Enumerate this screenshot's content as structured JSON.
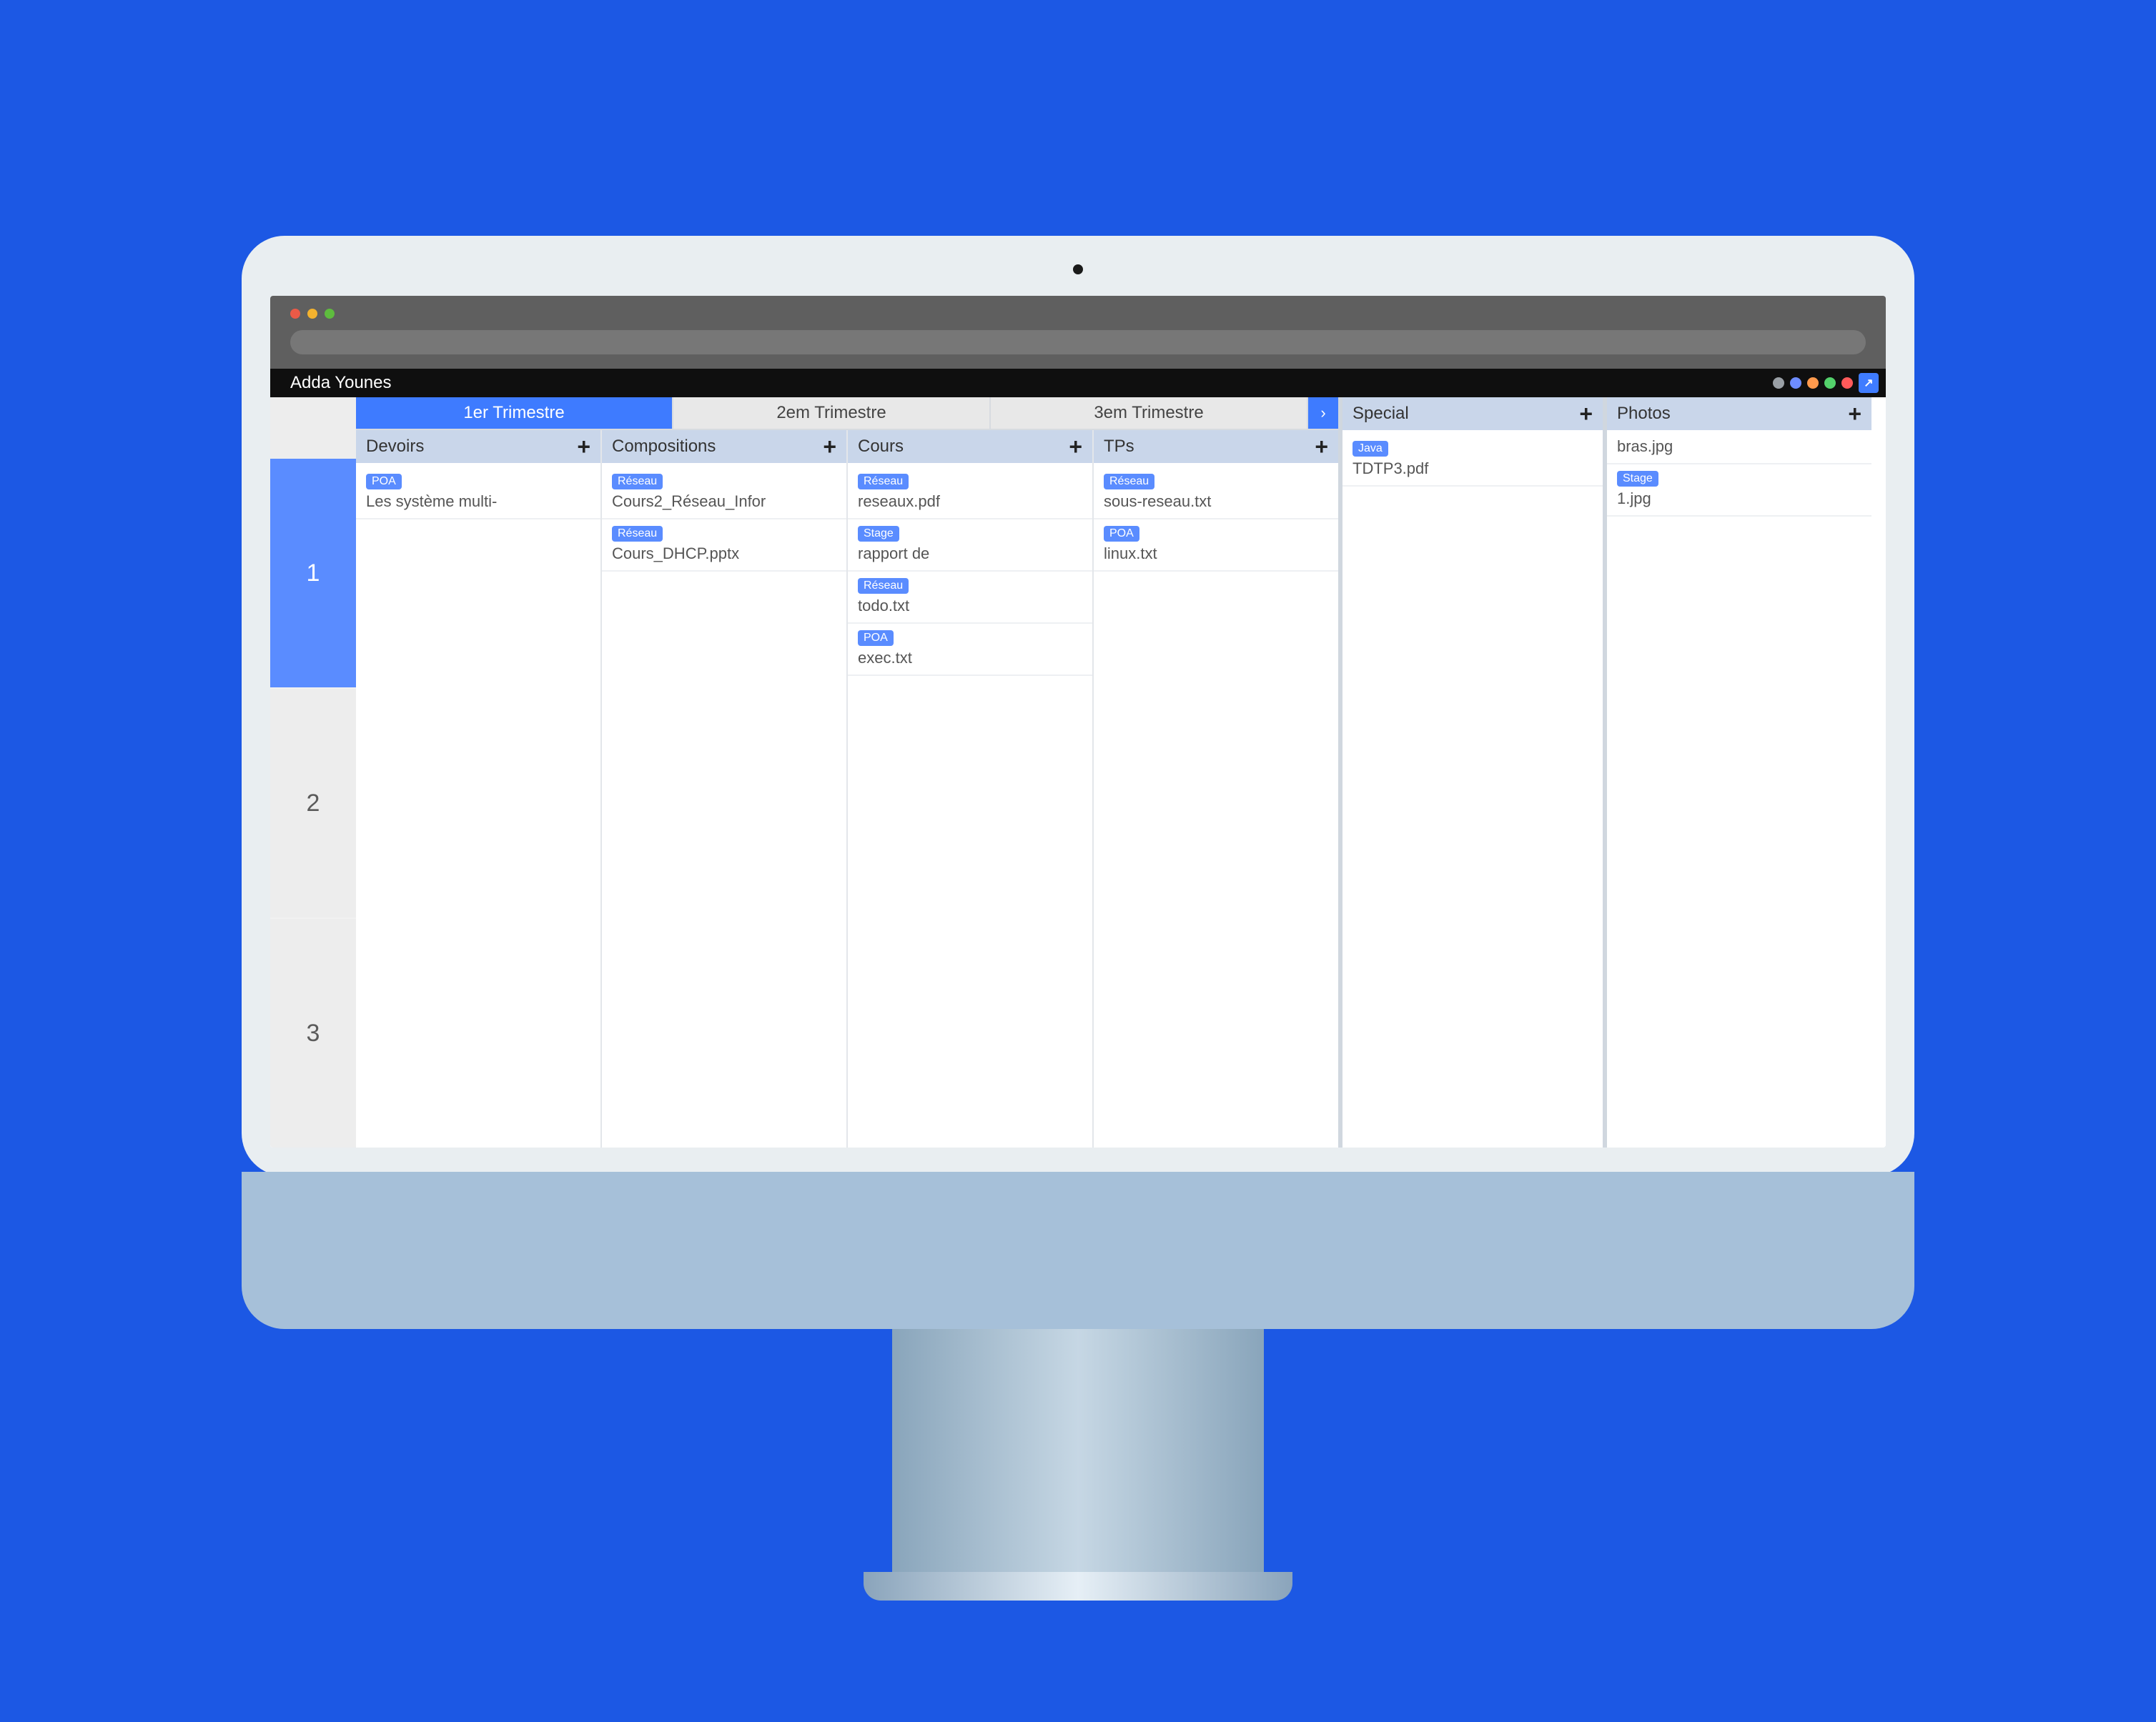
{
  "topbar": {
    "user": "Adda Younes"
  },
  "tabs": [
    "1er Trimestre",
    "2em Trimestre",
    "3em Trimestre"
  ],
  "tabs_nav_next": "›",
  "active_tab": 0,
  "rail": [
    "1",
    "2",
    "3"
  ],
  "columns": [
    {
      "title": "Devoirs",
      "items": [
        {
          "tag": "POA",
          "name": "Les système multi-"
        }
      ]
    },
    {
      "title": "Compositions",
      "items": [
        {
          "tag": "Réseau",
          "name": "Cours2_Réseau_Infor"
        },
        {
          "tag": "Réseau",
          "name": "Cours_DHCP.pptx"
        }
      ]
    },
    {
      "title": "Cours",
      "items": [
        {
          "tag": "Réseau",
          "name": "reseaux.pdf"
        },
        {
          "tag": "Stage",
          "name": "rapport de"
        },
        {
          "tag": "Réseau",
          "name": "todo.txt"
        },
        {
          "tag": "POA",
          "name": "exec.txt"
        }
      ]
    },
    {
      "title": "TPs",
      "items": [
        {
          "tag": "Réseau",
          "name": "sous-reseau.txt"
        },
        {
          "tag": "POA",
          "name": "linux.txt"
        }
      ]
    }
  ],
  "panes": [
    {
      "title": "Special",
      "items": [
        {
          "tag": "Java",
          "name": "TDTP3.pdf"
        }
      ]
    },
    {
      "title": "Photos",
      "items": [
        {
          "tag": null,
          "name": "bras.jpg"
        },
        {
          "tag": "Stage",
          "name": "1.jpg"
        }
      ]
    }
  ],
  "glyphs": {
    "plus": "+"
  }
}
